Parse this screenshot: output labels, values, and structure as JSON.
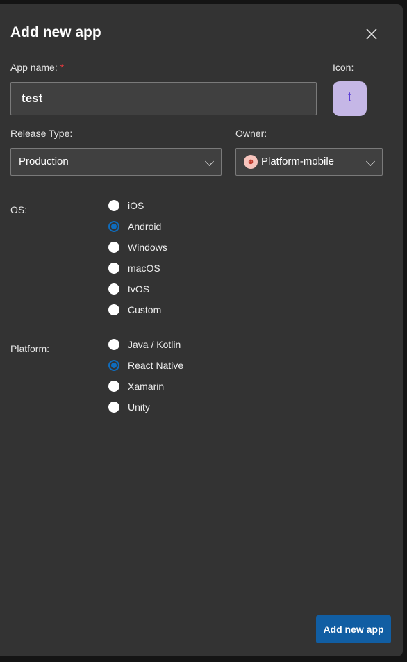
{
  "dialog": {
    "title": "Add new app"
  },
  "app_name": {
    "label": "App name:",
    "required_mark": "*",
    "value": "test"
  },
  "icon": {
    "label": "Icon:",
    "letter": "t",
    "bg": "#c5b7e6"
  },
  "release_type": {
    "label": "Release Type:",
    "value": "Production"
  },
  "owner": {
    "label": "Owner:",
    "value": "Platform-mobile",
    "avatar": "people-icon"
  },
  "os": {
    "label": "OS:",
    "options": [
      {
        "label": "iOS",
        "selected": false
      },
      {
        "label": "Android",
        "selected": true
      },
      {
        "label": "Windows",
        "selected": false
      },
      {
        "label": "macOS",
        "selected": false
      },
      {
        "label": "tvOS",
        "selected": false
      },
      {
        "label": "Custom",
        "selected": false
      }
    ]
  },
  "platform": {
    "label": "Platform:",
    "options": [
      {
        "label": "Java / Kotlin",
        "selected": false
      },
      {
        "label": "React Native",
        "selected": true
      },
      {
        "label": "Xamarin",
        "selected": false
      },
      {
        "label": "Unity",
        "selected": false
      }
    ]
  },
  "footer": {
    "submit_label": "Add new app"
  },
  "colors": {
    "accent": "#0f6cbd",
    "button": "#115ea3",
    "panel": "#333333"
  }
}
